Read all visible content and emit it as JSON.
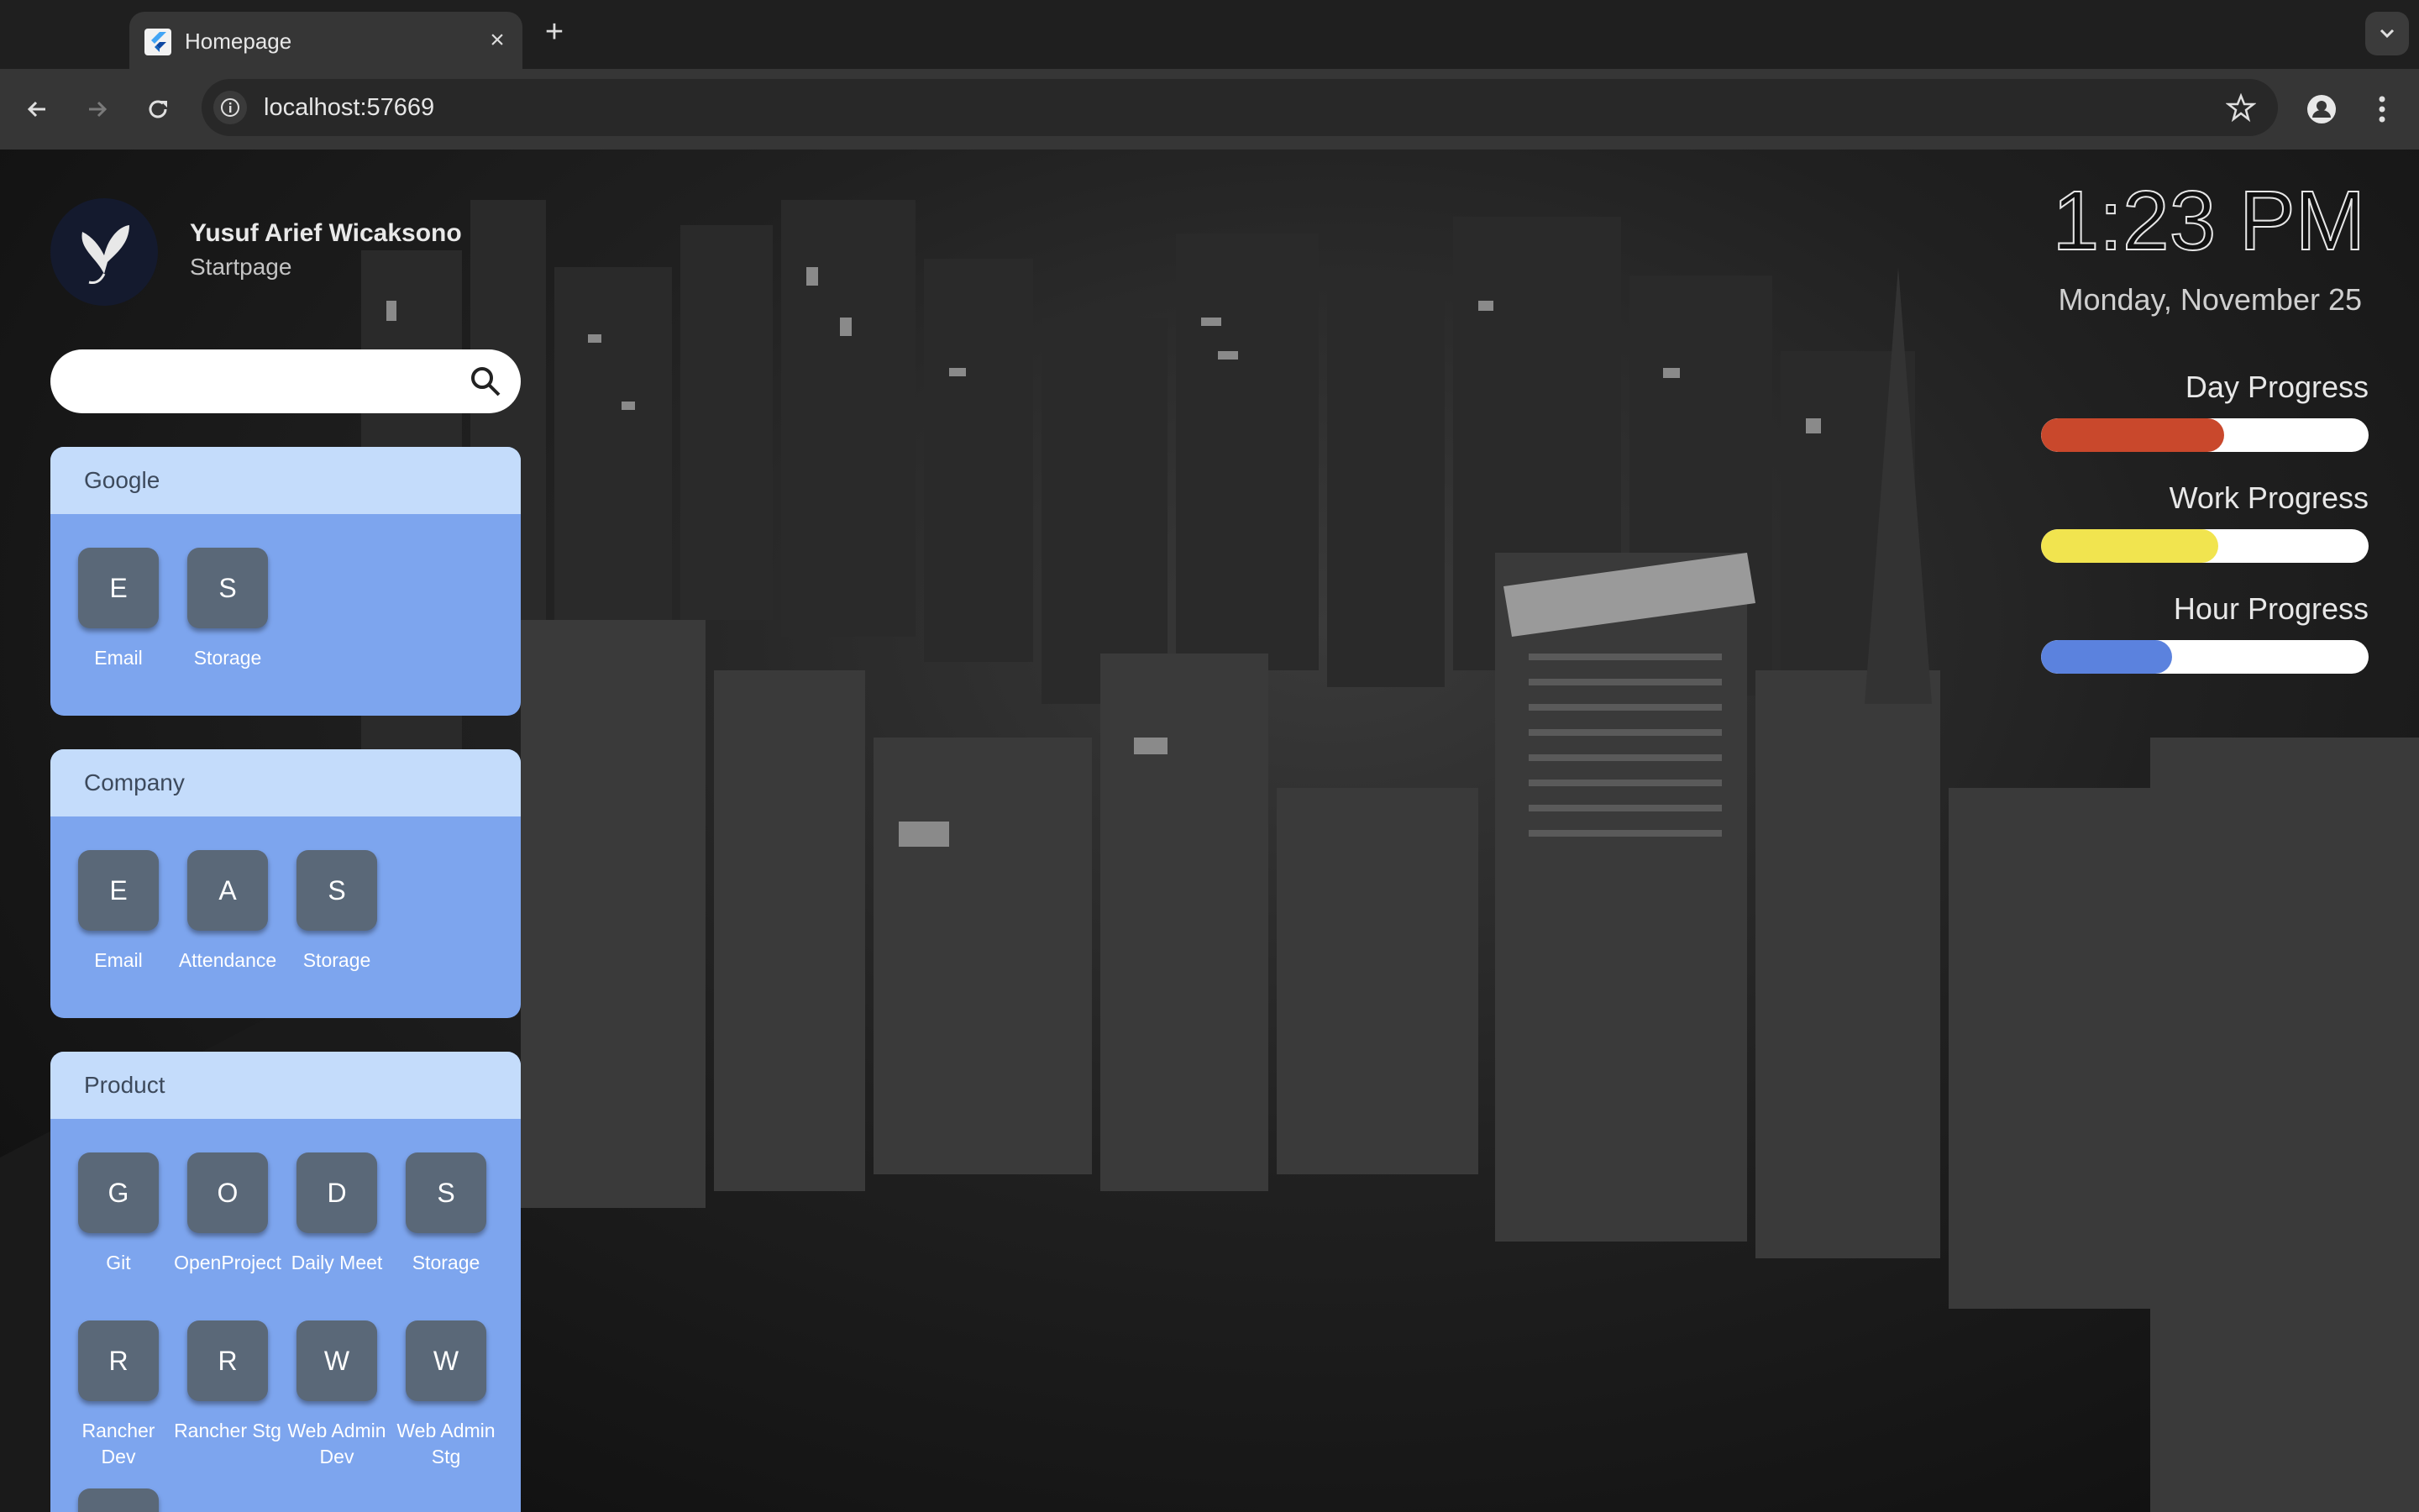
{
  "browser": {
    "tab_title": "Homepage",
    "url": "localhost:57669",
    "new_tab_glyph": "+",
    "close_glyph": "×"
  },
  "profile": {
    "name": "Yusuf Arief Wicaksono",
    "subtitle": "Startpage"
  },
  "search": {
    "placeholder": "",
    "value": ""
  },
  "groups": [
    {
      "title": "Google",
      "items": [
        {
          "letter": "E",
          "label": "Email"
        },
        {
          "letter": "S",
          "label": "Storage"
        }
      ]
    },
    {
      "title": "Company",
      "items": [
        {
          "letter": "E",
          "label": "Email"
        },
        {
          "letter": "A",
          "label": "Attendance"
        },
        {
          "letter": "S",
          "label": "Storage"
        }
      ]
    },
    {
      "title": "Product",
      "items": [
        {
          "letter": "G",
          "label": "Git"
        },
        {
          "letter": "O",
          "label": "OpenProject"
        },
        {
          "letter": "D",
          "label": "Daily Meet"
        },
        {
          "letter": "S",
          "label": "Storage"
        },
        {
          "letter": "R",
          "label": "Rancher Dev"
        },
        {
          "letter": "R",
          "label": "Rancher Stg"
        },
        {
          "letter": "W",
          "label": "Web Admin Dev"
        },
        {
          "letter": "W",
          "label": "Web Admin Stg"
        }
      ]
    }
  ],
  "clock": {
    "time": "1:23 PM",
    "date": "Monday, November 25"
  },
  "progress": [
    {
      "label": "Day Progress",
      "fraction": 0.56,
      "color": "#c9482c"
    },
    {
      "label": "Work Progress",
      "fraction": 0.54,
      "color": "#f1e44f"
    },
    {
      "label": "Hour Progress",
      "fraction": 0.4,
      "color": "#5b82de"
    }
  ]
}
